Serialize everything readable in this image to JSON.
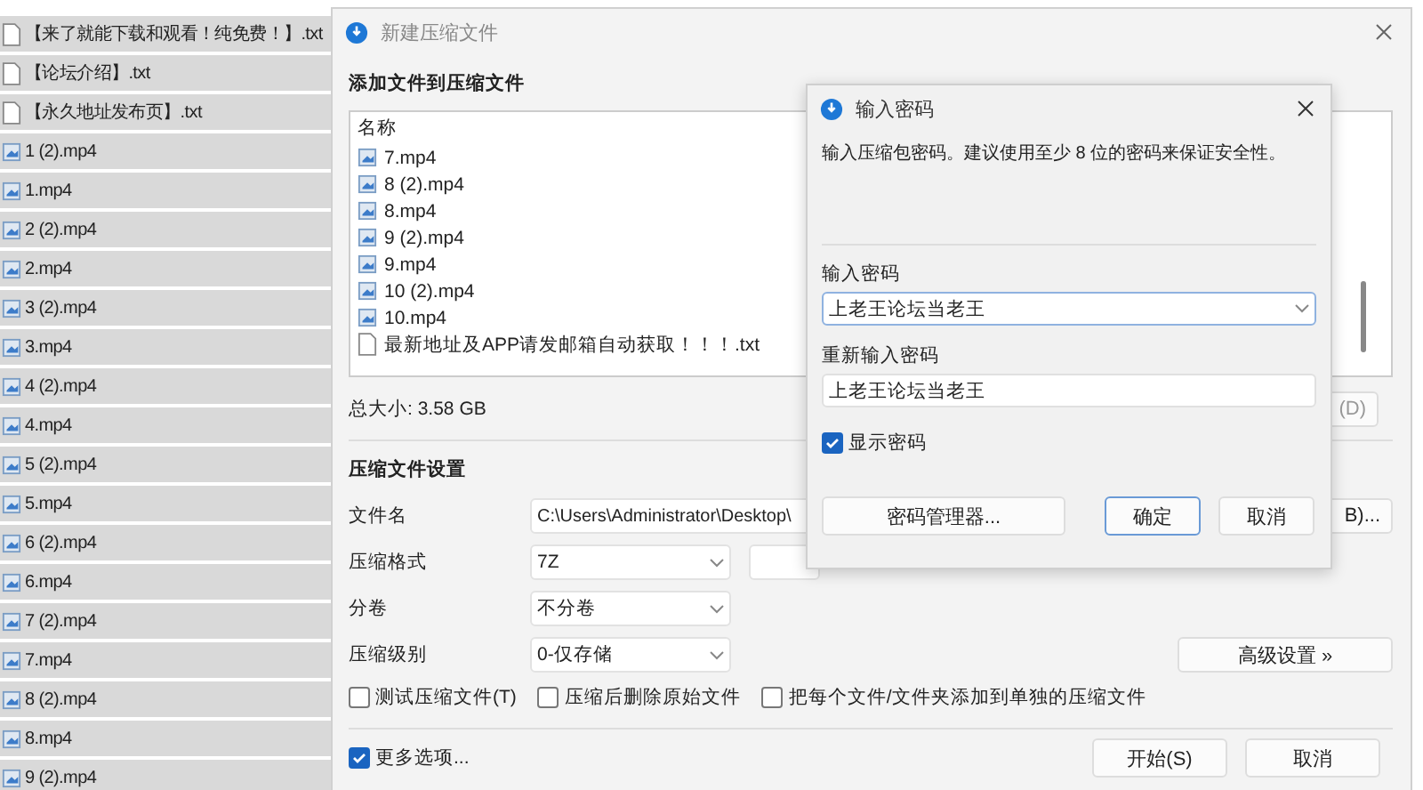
{
  "file_list": [
    {
      "name": "【来了就能下载和观看！纯免费！】.txt",
      "kind": "txt"
    },
    {
      "name": "【论坛介绍】.txt",
      "kind": "txt"
    },
    {
      "name": "【永久地址发布页】.txt",
      "kind": "txt"
    },
    {
      "name": "1 (2).mp4",
      "kind": "video"
    },
    {
      "name": "1.mp4",
      "kind": "video"
    },
    {
      "name": "2 (2).mp4",
      "kind": "video"
    },
    {
      "name": "2.mp4",
      "kind": "video"
    },
    {
      "name": "3 (2).mp4",
      "kind": "video"
    },
    {
      "name": "3.mp4",
      "kind": "video"
    },
    {
      "name": "4 (2).mp4",
      "kind": "video"
    },
    {
      "name": "4.mp4",
      "kind": "video"
    },
    {
      "name": "5 (2).mp4",
      "kind": "video"
    },
    {
      "name": "5.mp4",
      "kind": "video"
    },
    {
      "name": "6 (2).mp4",
      "kind": "video"
    },
    {
      "name": "6.mp4",
      "kind": "video"
    },
    {
      "name": "7 (2).mp4",
      "kind": "video"
    },
    {
      "name": "7.mp4",
      "kind": "video"
    },
    {
      "name": "8 (2).mp4",
      "kind": "video"
    },
    {
      "name": "8.mp4",
      "kind": "video"
    },
    {
      "name": "9 (2).mp4",
      "kind": "video"
    }
  ],
  "compress_dialog": {
    "title": "新建压缩文件",
    "add_heading": "添加文件到压缩文件",
    "files_header": "名称",
    "files": [
      {
        "name": "7.mp4",
        "kind": "video"
      },
      {
        "name": "8 (2).mp4",
        "kind": "video"
      },
      {
        "name": "8.mp4",
        "kind": "video"
      },
      {
        "name": "9 (2).mp4",
        "kind": "video"
      },
      {
        "name": "9.mp4",
        "kind": "video"
      },
      {
        "name": "10 (2).mp4",
        "kind": "video"
      },
      {
        "name": "10.mp4",
        "kind": "video"
      },
      {
        "name": "最新地址及APP请发邮箱自动获取！！！.txt",
        "kind": "txt"
      }
    ],
    "total_size": "总大小: 3.58 GB",
    "side_button": "(D)",
    "settings_heading": "压缩文件设置",
    "fields": [
      {
        "label": "文件名",
        "value": "C:\\Users\\Administrator\\Desktop\\",
        "kind": "text",
        "button": "B)..."
      },
      {
        "label": "压缩格式",
        "value": "7Z",
        "kind": "select",
        "extra_field": true
      },
      {
        "label": "分卷",
        "value": "不分卷",
        "kind": "select"
      },
      {
        "label": "压缩级别",
        "value": "0-仅存储",
        "kind": "select",
        "button": "高级设置 »"
      }
    ],
    "checkboxes": [
      {
        "label": "测试压缩文件(T)",
        "checked": false
      },
      {
        "label": "压缩后删除原始文件",
        "checked": false
      },
      {
        "label": "把每个文件/文件夹添加到单独的压缩文件",
        "checked": false
      }
    ],
    "more_options": {
      "label": "更多选项...",
      "checked": true
    },
    "buttons": [
      {
        "label": "开始(S)"
      },
      {
        "label": "取消"
      }
    ]
  },
  "password_dialog": {
    "title": "输入密码",
    "message": "输入压缩包密码。建议使用至少 8 位的密码来保证安全性。",
    "password_label": "输入密码",
    "password_value": "上老王论坛当老王",
    "confirm_label": "重新输入密码",
    "confirm_value": "上老王论坛当老王",
    "show_password": {
      "label": "显示密码",
      "checked": true
    },
    "buttons": [
      {
        "label": "密码管理器...",
        "default": false
      },
      {
        "label": "确定",
        "default": true
      },
      {
        "label": "取消",
        "default": false
      }
    ]
  }
}
